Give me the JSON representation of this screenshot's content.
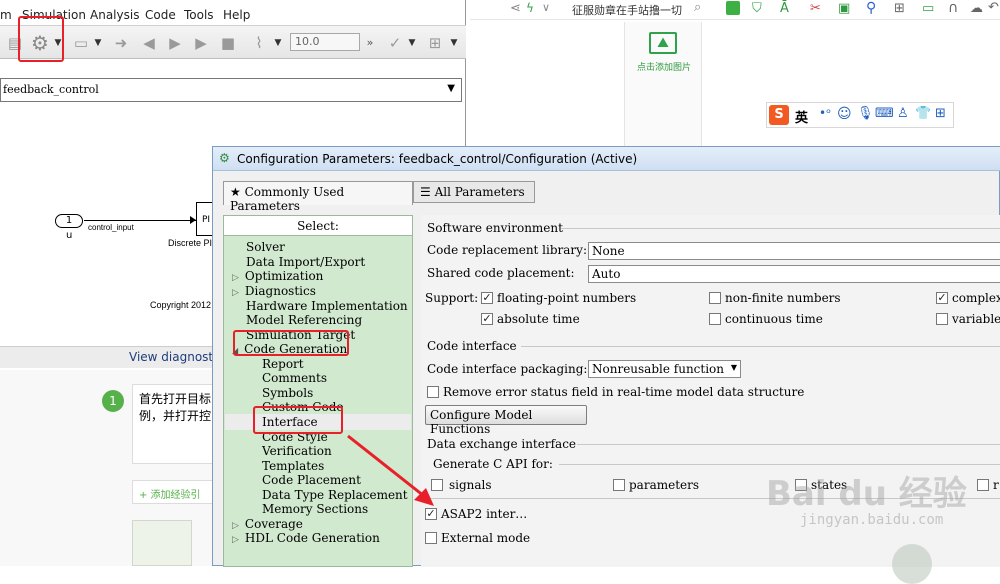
{
  "simulink": {
    "menu": [
      "m",
      "Simulation",
      "Analysis",
      "Code",
      "Tools",
      "Help"
    ],
    "stop_time": "10.0",
    "model_path": "feedback_control",
    "block_inport_number": "1",
    "block_inport_label": "u",
    "signal_label": "control_input",
    "block_pid": "PI",
    "block_pid_label": "Discrete PI",
    "copyright": "Copyright 2012",
    "view_diagnostics": "View diagnostic"
  },
  "browser": {
    "toolbar_text": "征服勋章在手站撸一切",
    "add_image": "点击添加图片",
    "ime_label": "英"
  },
  "step": {
    "number": "1",
    "text_line1": "首先打开目标",
    "text_line2": "例，并打开控",
    "add_link": "+ 添加经验引"
  },
  "dialog": {
    "title": "Configuration Parameters: feedback_control/Configuration (Active)",
    "tabs": [
      "★ Commonly Used Parameters",
      "☰ All Parameters"
    ],
    "select_label": "Select:",
    "tree": [
      {
        "label": "Solver",
        "expander": ""
      },
      {
        "label": "Data Import/Export",
        "expander": ""
      },
      {
        "label": "Optimization",
        "expander": "▷"
      },
      {
        "label": "Diagnostics",
        "expander": "▷"
      },
      {
        "label": "Hardware Implementation",
        "expander": ""
      },
      {
        "label": "Model Referencing",
        "expander": ""
      },
      {
        "label": "Simulation Target",
        "expander": ""
      },
      {
        "label": "Code Generation",
        "expander": "◢"
      },
      {
        "label": "Report",
        "expander": ""
      },
      {
        "label": "Comments",
        "expander": ""
      },
      {
        "label": "Symbols",
        "expander": ""
      },
      {
        "label": "Custom Code",
        "expander": ""
      },
      {
        "label": "Interface",
        "expander": ""
      },
      {
        "label": "Code Style",
        "expander": ""
      },
      {
        "label": "Verification",
        "expander": ""
      },
      {
        "label": "Templates",
        "expander": ""
      },
      {
        "label": "Code Placement",
        "expander": ""
      },
      {
        "label": "Data Type Replacement",
        "expander": ""
      },
      {
        "label": "Memory Sections",
        "expander": ""
      },
      {
        "label": "Coverage",
        "expander": "▷"
      },
      {
        "label": "HDL Code Generation",
        "expander": "▷"
      }
    ],
    "software_env": {
      "heading": "Software environment",
      "code_repl_label": "Code replacement library:",
      "code_repl_value": "None",
      "shared_label": "Shared code placement:",
      "shared_value": "Auto",
      "support_label": "Support:",
      "floating_point": "floating-point numbers",
      "non_finite": "non-finite numbers",
      "complex": "complex",
      "absolute_time": "absolute time",
      "continuous_time": "continuous time",
      "variable": "variable"
    },
    "code_interface": {
      "heading": "Code interface",
      "packaging_label": "Code interface packaging:",
      "packaging_value": "Nonreusable function",
      "remove_error": "Remove error status field in real-time model data structure",
      "configure_button": "Configure Model Functions"
    },
    "data_exchange": {
      "heading": "Data exchange interface",
      "generate_c_api": "Generate C API for:",
      "signals": "signals",
      "parameters": "parameters",
      "states": "states",
      "root": "r",
      "asap2": "ASAP2 inter…",
      "external_mode": "External mode"
    }
  },
  "watermark": {
    "logo": "Bai du 经验",
    "url": "jingyan.baidu.com"
  },
  "colors": {
    "highlight": "#e8202a",
    "tree_bg": "#d1e9cf",
    "step_green": "#57b14a"
  }
}
